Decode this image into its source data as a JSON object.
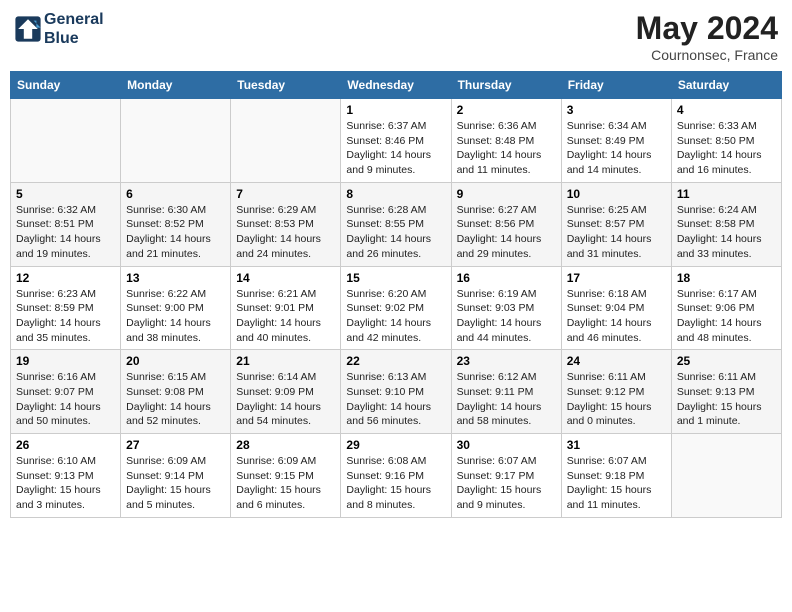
{
  "header": {
    "logo_line1": "General",
    "logo_line2": "Blue",
    "month_year": "May 2024",
    "location": "Cournonsec, France"
  },
  "days_of_week": [
    "Sunday",
    "Monday",
    "Tuesday",
    "Wednesday",
    "Thursday",
    "Friday",
    "Saturday"
  ],
  "weeks": [
    [
      {
        "day": "",
        "info": ""
      },
      {
        "day": "",
        "info": ""
      },
      {
        "day": "",
        "info": ""
      },
      {
        "day": "1",
        "info": "Sunrise: 6:37 AM\nSunset: 8:46 PM\nDaylight: 14 hours\nand 9 minutes."
      },
      {
        "day": "2",
        "info": "Sunrise: 6:36 AM\nSunset: 8:48 PM\nDaylight: 14 hours\nand 11 minutes."
      },
      {
        "day": "3",
        "info": "Sunrise: 6:34 AM\nSunset: 8:49 PM\nDaylight: 14 hours\nand 14 minutes."
      },
      {
        "day": "4",
        "info": "Sunrise: 6:33 AM\nSunset: 8:50 PM\nDaylight: 14 hours\nand 16 minutes."
      }
    ],
    [
      {
        "day": "5",
        "info": "Sunrise: 6:32 AM\nSunset: 8:51 PM\nDaylight: 14 hours\nand 19 minutes."
      },
      {
        "day": "6",
        "info": "Sunrise: 6:30 AM\nSunset: 8:52 PM\nDaylight: 14 hours\nand 21 minutes."
      },
      {
        "day": "7",
        "info": "Sunrise: 6:29 AM\nSunset: 8:53 PM\nDaylight: 14 hours\nand 24 minutes."
      },
      {
        "day": "8",
        "info": "Sunrise: 6:28 AM\nSunset: 8:55 PM\nDaylight: 14 hours\nand 26 minutes."
      },
      {
        "day": "9",
        "info": "Sunrise: 6:27 AM\nSunset: 8:56 PM\nDaylight: 14 hours\nand 29 minutes."
      },
      {
        "day": "10",
        "info": "Sunrise: 6:25 AM\nSunset: 8:57 PM\nDaylight: 14 hours\nand 31 minutes."
      },
      {
        "day": "11",
        "info": "Sunrise: 6:24 AM\nSunset: 8:58 PM\nDaylight: 14 hours\nand 33 minutes."
      }
    ],
    [
      {
        "day": "12",
        "info": "Sunrise: 6:23 AM\nSunset: 8:59 PM\nDaylight: 14 hours\nand 35 minutes."
      },
      {
        "day": "13",
        "info": "Sunrise: 6:22 AM\nSunset: 9:00 PM\nDaylight: 14 hours\nand 38 minutes."
      },
      {
        "day": "14",
        "info": "Sunrise: 6:21 AM\nSunset: 9:01 PM\nDaylight: 14 hours\nand 40 minutes."
      },
      {
        "day": "15",
        "info": "Sunrise: 6:20 AM\nSunset: 9:02 PM\nDaylight: 14 hours\nand 42 minutes."
      },
      {
        "day": "16",
        "info": "Sunrise: 6:19 AM\nSunset: 9:03 PM\nDaylight: 14 hours\nand 44 minutes."
      },
      {
        "day": "17",
        "info": "Sunrise: 6:18 AM\nSunset: 9:04 PM\nDaylight: 14 hours\nand 46 minutes."
      },
      {
        "day": "18",
        "info": "Sunrise: 6:17 AM\nSunset: 9:06 PM\nDaylight: 14 hours\nand 48 minutes."
      }
    ],
    [
      {
        "day": "19",
        "info": "Sunrise: 6:16 AM\nSunset: 9:07 PM\nDaylight: 14 hours\nand 50 minutes."
      },
      {
        "day": "20",
        "info": "Sunrise: 6:15 AM\nSunset: 9:08 PM\nDaylight: 14 hours\nand 52 minutes."
      },
      {
        "day": "21",
        "info": "Sunrise: 6:14 AM\nSunset: 9:09 PM\nDaylight: 14 hours\nand 54 minutes."
      },
      {
        "day": "22",
        "info": "Sunrise: 6:13 AM\nSunset: 9:10 PM\nDaylight: 14 hours\nand 56 minutes."
      },
      {
        "day": "23",
        "info": "Sunrise: 6:12 AM\nSunset: 9:11 PM\nDaylight: 14 hours\nand 58 minutes."
      },
      {
        "day": "24",
        "info": "Sunrise: 6:11 AM\nSunset: 9:12 PM\nDaylight: 15 hours\nand 0 minutes."
      },
      {
        "day": "25",
        "info": "Sunrise: 6:11 AM\nSunset: 9:13 PM\nDaylight: 15 hours\nand 1 minute."
      }
    ],
    [
      {
        "day": "26",
        "info": "Sunrise: 6:10 AM\nSunset: 9:13 PM\nDaylight: 15 hours\nand 3 minutes."
      },
      {
        "day": "27",
        "info": "Sunrise: 6:09 AM\nSunset: 9:14 PM\nDaylight: 15 hours\nand 5 minutes."
      },
      {
        "day": "28",
        "info": "Sunrise: 6:09 AM\nSunset: 9:15 PM\nDaylight: 15 hours\nand 6 minutes."
      },
      {
        "day": "29",
        "info": "Sunrise: 6:08 AM\nSunset: 9:16 PM\nDaylight: 15 hours\nand 8 minutes."
      },
      {
        "day": "30",
        "info": "Sunrise: 6:07 AM\nSunset: 9:17 PM\nDaylight: 15 hours\nand 9 minutes."
      },
      {
        "day": "31",
        "info": "Sunrise: 6:07 AM\nSunset: 9:18 PM\nDaylight: 15 hours\nand 11 minutes."
      },
      {
        "day": "",
        "info": ""
      }
    ]
  ]
}
